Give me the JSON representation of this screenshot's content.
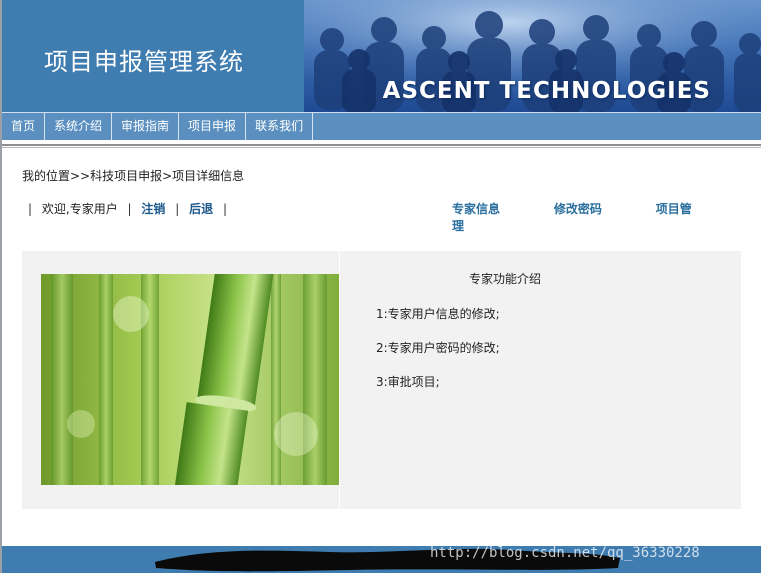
{
  "header": {
    "title": "项目申报管理系统",
    "banner_text": "ASCENT TECHNOLOGIES"
  },
  "nav": {
    "items": [
      "首页",
      "系统介绍",
      "审报指南",
      "项目申报",
      "联系我们"
    ]
  },
  "breadcrumb": "我的位置>>科技项目申报>项目详细信息",
  "user_bar": {
    "welcome": "欢迎,专家用户",
    "logout": "注销",
    "back": "后退",
    "links": [
      "专家信息",
      "修改密码",
      "项目管理"
    ]
  },
  "content": {
    "intro_title": "专家功能介绍",
    "intro_lines": [
      "1:专家用户信息的修改;",
      "2:专家用户密码的修改;",
      "3:审批项目;"
    ]
  },
  "footer": {
    "watermark": "http://blog.csdn.net/qq_36330228"
  },
  "colors": {
    "header_blue": "#3f7cb0",
    "nav_blue": "#5a8fc0",
    "link_blue": "#2a6f9e",
    "panel_gray": "#f2f2f2"
  }
}
